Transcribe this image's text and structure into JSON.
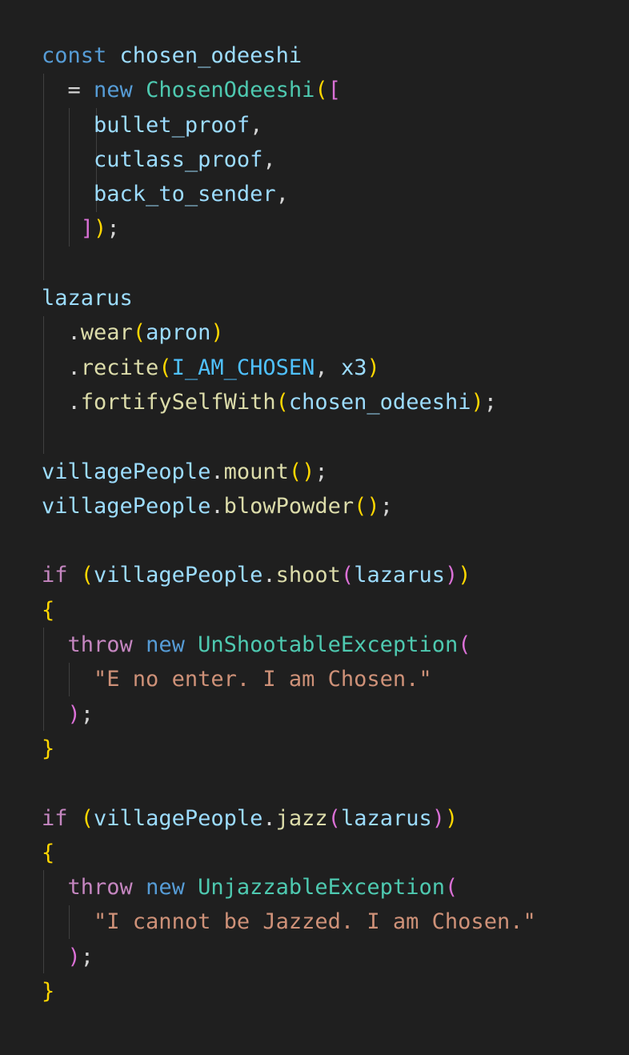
{
  "editor": {
    "background": "#1f1f1f",
    "lines": [
      [
        [
          "const",
          "kw"
        ],
        [
          " ",
          "pun"
        ],
        [
          "chosen_odeeshi",
          "var"
        ]
      ],
      [
        [
          "  ",
          "pun"
        ],
        [
          "=",
          "pun"
        ],
        [
          " ",
          "pun"
        ],
        [
          "new",
          "kw"
        ],
        [
          " ",
          "pun"
        ],
        [
          "ChosenOdeeshi",
          "cls"
        ],
        [
          "(",
          "b1"
        ],
        [
          "[",
          "b2"
        ]
      ],
      [
        [
          "    ",
          "pun"
        ],
        [
          "bullet_proof",
          "var"
        ],
        [
          ",",
          "pun"
        ]
      ],
      [
        [
          "    ",
          "pun"
        ],
        [
          "cutlass_proof",
          "var"
        ],
        [
          ",",
          "pun"
        ]
      ],
      [
        [
          "    ",
          "pun"
        ],
        [
          "back_to_sender",
          "var"
        ],
        [
          ",",
          "pun"
        ]
      ],
      [
        [
          "   ",
          "pun"
        ],
        [
          "]",
          "b2"
        ],
        [
          ")",
          "b1"
        ],
        [
          ";",
          "pun"
        ]
      ],
      [],
      [
        [
          "lazarus",
          "var"
        ]
      ],
      [
        [
          "  ",
          "pun"
        ],
        [
          ".",
          "pun"
        ],
        [
          "wear",
          "fn"
        ],
        [
          "(",
          "b1"
        ],
        [
          "apron",
          "var"
        ],
        [
          ")",
          "b1"
        ]
      ],
      [
        [
          "  ",
          "pun"
        ],
        [
          ".",
          "pun"
        ],
        [
          "recite",
          "fn"
        ],
        [
          "(",
          "b1"
        ],
        [
          "I_AM_CHOSEN",
          "const"
        ],
        [
          ",",
          "pun"
        ],
        [
          " ",
          "pun"
        ],
        [
          "x3",
          "var"
        ],
        [
          ")",
          "b1"
        ]
      ],
      [
        [
          "  ",
          "pun"
        ],
        [
          ".",
          "pun"
        ],
        [
          "fortifySelfWith",
          "fn"
        ],
        [
          "(",
          "b1"
        ],
        [
          "chosen_odeeshi",
          "var"
        ],
        [
          ")",
          "b1"
        ],
        [
          ";",
          "pun"
        ]
      ],
      [],
      [
        [
          "villagePeople",
          "var"
        ],
        [
          ".",
          "pun"
        ],
        [
          "mount",
          "fn"
        ],
        [
          "(",
          "b1"
        ],
        [
          ")",
          "b1"
        ],
        [
          ";",
          "pun"
        ]
      ],
      [
        [
          "villagePeople",
          "var"
        ],
        [
          ".",
          "pun"
        ],
        [
          "blowPowder",
          "fn"
        ],
        [
          "(",
          "b1"
        ],
        [
          ")",
          "b1"
        ],
        [
          ";",
          "pun"
        ]
      ],
      [],
      [
        [
          "if",
          "ctl"
        ],
        [
          " ",
          "pun"
        ],
        [
          "(",
          "b1"
        ],
        [
          "villagePeople",
          "var"
        ],
        [
          ".",
          "pun"
        ],
        [
          "shoot",
          "fn"
        ],
        [
          "(",
          "b2"
        ],
        [
          "lazarus",
          "var"
        ],
        [
          ")",
          "b2"
        ],
        [
          ")",
          "b1"
        ]
      ],
      [
        [
          "{",
          "b1"
        ]
      ],
      [
        [
          "  ",
          "pun"
        ],
        [
          "throw",
          "ctl"
        ],
        [
          " ",
          "pun"
        ],
        [
          "new",
          "kw"
        ],
        [
          " ",
          "pun"
        ],
        [
          "UnShootableException",
          "cls"
        ],
        [
          "(",
          "b2"
        ]
      ],
      [
        [
          "    ",
          "pun"
        ],
        [
          "\"E no enter. I am Chosen.\"",
          "str"
        ]
      ],
      [
        [
          "  ",
          "pun"
        ],
        [
          ")",
          "b2"
        ],
        [
          ";",
          "pun"
        ]
      ],
      [
        [
          "}",
          "b1"
        ]
      ],
      [],
      [
        [
          "if",
          "ctl"
        ],
        [
          " ",
          "pun"
        ],
        [
          "(",
          "b1"
        ],
        [
          "villagePeople",
          "var"
        ],
        [
          ".",
          "pun"
        ],
        [
          "jazz",
          "fn"
        ],
        [
          "(",
          "b2"
        ],
        [
          "lazarus",
          "var"
        ],
        [
          ")",
          "b2"
        ],
        [
          ")",
          "b1"
        ]
      ],
      [
        [
          "{",
          "b1"
        ]
      ],
      [
        [
          "  ",
          "pun"
        ],
        [
          "throw",
          "ctl"
        ],
        [
          " ",
          "pun"
        ],
        [
          "new",
          "kw"
        ],
        [
          " ",
          "pun"
        ],
        [
          "UnjazzableException",
          "cls"
        ],
        [
          "(",
          "b2"
        ]
      ],
      [
        [
          "    ",
          "pun"
        ],
        [
          "\"I cannot be Jazzed. I am Chosen.\"",
          "str"
        ]
      ],
      [
        [
          "  ",
          "pun"
        ],
        [
          ")",
          "b2"
        ],
        [
          ";",
          "pun"
        ]
      ],
      [
        [
          "}",
          "b1"
        ]
      ]
    ]
  }
}
